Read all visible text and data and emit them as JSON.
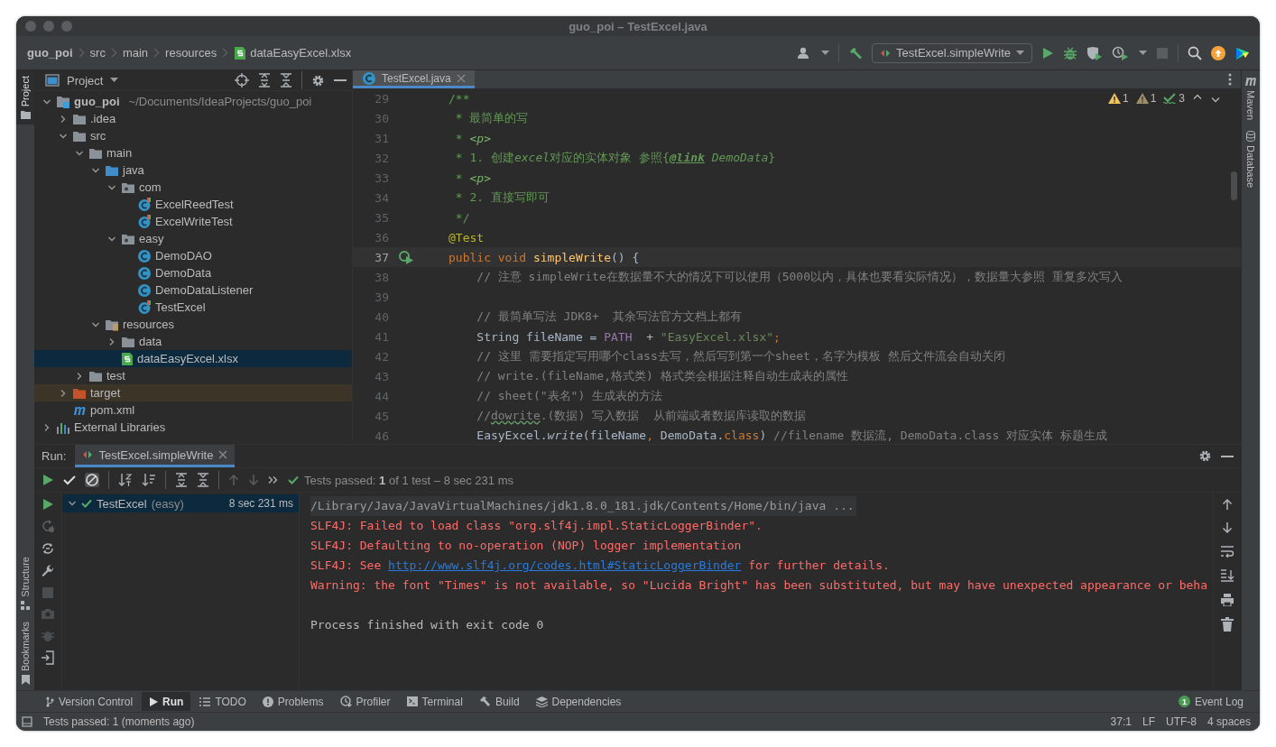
{
  "window": {
    "title": "guo_poi – TestExcel.java"
  },
  "breadcrumbs": [
    {
      "label": "guo_poi",
      "kind": "project"
    },
    {
      "label": "src",
      "kind": "folder"
    },
    {
      "label": "main",
      "kind": "folder"
    },
    {
      "label": "resources",
      "kind": "folder"
    },
    {
      "label": "dataEasyExcel.xlsx",
      "kind": "xlsx"
    }
  ],
  "run_config": {
    "label": "TestExcel.simpleWrite"
  },
  "left_stripe": [
    {
      "label": "Project",
      "selected": true,
      "kind": "project"
    },
    {
      "label": "Structure",
      "selected": false,
      "kind": "structure"
    },
    {
      "label": "Bookmarks",
      "selected": false,
      "kind": "bookmarks"
    }
  ],
  "right_stripe": [
    {
      "label": "Maven",
      "kind": "maven"
    },
    {
      "label": "Database",
      "kind": "database"
    }
  ],
  "project_panel": {
    "title": "Project",
    "tree": [
      {
        "name": "guo_poi",
        "path": "~/Documents/IdeaProjects/guo_poi",
        "kind": "module",
        "expanded": true,
        "selected": false,
        "children": [
          {
            "name": ".idea",
            "kind": "folder",
            "expanded": false,
            "selected": false
          },
          {
            "name": "src",
            "kind": "folder",
            "expanded": true,
            "selected": false,
            "children": [
              {
                "name": "main",
                "kind": "folder",
                "expanded": true,
                "selected": false,
                "children": [
                  {
                    "name": "java",
                    "kind": "source",
                    "expanded": true,
                    "selected": false,
                    "children": [
                      {
                        "name": "com",
                        "kind": "package",
                        "expanded": true,
                        "selected": false,
                        "children": [
                          {
                            "name": "ExcelReedTest",
                            "kind": "testclass",
                            "selected": false
                          },
                          {
                            "name": "ExcelWriteTest",
                            "kind": "testclass",
                            "selected": false
                          }
                        ]
                      },
                      {
                        "name": "easy",
                        "kind": "package",
                        "expanded": true,
                        "selected": false,
                        "children": [
                          {
                            "name": "DemoDAO",
                            "kind": "class",
                            "selected": false
                          },
                          {
                            "name": "DemoData",
                            "kind": "class",
                            "selected": false
                          },
                          {
                            "name": "DemoDataListener",
                            "kind": "class",
                            "selected": false
                          },
                          {
                            "name": "TestExcel",
                            "kind": "testclass",
                            "selected": false
                          }
                        ]
                      }
                    ]
                  },
                  {
                    "name": "resources",
                    "kind": "resources",
                    "expanded": true,
                    "selected": false,
                    "children": [
                      {
                        "name": "data",
                        "kind": "folder",
                        "expanded": false,
                        "selected": false
                      },
                      {
                        "name": "dataEasyExcel.xlsx",
                        "kind": "xlsx",
                        "selected": true
                      }
                    ]
                  }
                ]
              },
              {
                "name": "test",
                "kind": "folder",
                "expanded": false,
                "selected": false
              }
            ]
          },
          {
            "name": "target",
            "kind": "excluded",
            "expanded": false,
            "selected": false
          },
          {
            "name": "pom.xml",
            "kind": "maven",
            "selected": false
          }
        ]
      },
      {
        "name": "External Libraries",
        "kind": "libraries",
        "expanded": false,
        "selected": false
      }
    ]
  },
  "editor": {
    "tabs": [
      {
        "label": "TestExcel.java",
        "selected": true
      }
    ],
    "inspections": [
      {
        "kind": "warning",
        "count": "1"
      },
      {
        "kind": "weak",
        "count": "1"
      },
      {
        "kind": "typo",
        "count": "3"
      }
    ],
    "lines": [
      {
        "number": "29",
        "current": false,
        "run": false,
        "tokens": [
          {
            "kind": "doc",
            "text": "/**"
          }
        ]
      },
      {
        "number": "30",
        "current": false,
        "run": false,
        "tokens": [
          {
            "kind": "doc",
            "text": " * 最简单的写"
          }
        ]
      },
      {
        "number": "31",
        "current": false,
        "run": false,
        "tokens": [
          {
            "kind": "doc",
            "text": " * "
          },
          {
            "kind": "doctag",
            "text": "<p>"
          }
        ]
      },
      {
        "number": "32",
        "current": false,
        "run": false,
        "tokens": [
          {
            "kind": "doc",
            "text": " * 1. 创建"
          },
          {
            "kind": "doci",
            "text": "excel"
          },
          {
            "kind": "doc",
            "text": "对应的实体对象 参照{"
          },
          {
            "kind": "doclink",
            "text": "@link"
          },
          {
            "kind": "doci",
            "text": " DemoData"
          },
          {
            "kind": "doc",
            "text": "}"
          }
        ]
      },
      {
        "number": "33",
        "current": false,
        "run": false,
        "tokens": [
          {
            "kind": "doc",
            "text": " * "
          },
          {
            "kind": "doctag",
            "text": "<p>"
          }
        ]
      },
      {
        "number": "34",
        "current": false,
        "run": false,
        "tokens": [
          {
            "kind": "doc",
            "text": " * 2. 直接写即可"
          }
        ]
      },
      {
        "number": "35",
        "current": false,
        "run": false,
        "tokens": [
          {
            "kind": "doc",
            "text": " */"
          }
        ]
      },
      {
        "number": "36",
        "current": false,
        "run": false,
        "tokens": [
          {
            "kind": "annotation",
            "text": "@Test"
          }
        ]
      },
      {
        "number": "37",
        "current": true,
        "run": true,
        "tokens": [
          {
            "kind": "keyword",
            "text": "public void "
          },
          {
            "kind": "method",
            "text": "simpleWrite"
          },
          {
            "kind": "plain",
            "text": "() {"
          }
        ]
      },
      {
        "number": "38",
        "current": false,
        "run": false,
        "tokens": [
          {
            "kind": "comment",
            "text": "    // 注意 simpleWrite在数据量不大的情况下可以使用（5000以内，具体也要看实际情况），数据量大参照 重复多次写入"
          }
        ]
      },
      {
        "number": "39",
        "current": false,
        "run": false
      },
      {
        "number": "40",
        "current": false,
        "run": false,
        "tokens": [
          {
            "kind": "comment",
            "text": "    // 最简单写法 JDK8+  其余写法官方文档上都有"
          }
        ]
      },
      {
        "number": "41",
        "current": false,
        "run": false,
        "tokens": [
          {
            "kind": "plain",
            "text": "    String fileName = "
          },
          {
            "kind": "field",
            "text": "PATH"
          },
          {
            "kind": "plain",
            "text": "  + "
          },
          {
            "kind": "string",
            "text": "\"EasyExcel.xlsx\""
          },
          {
            "kind": "keyword",
            "text": ";"
          }
        ]
      },
      {
        "number": "42",
        "current": false,
        "run": false,
        "tokens": [
          {
            "kind": "comment",
            "text": "    // 这里 需要指定写用哪个class去写，然后写到第一个sheet，名字为模板 然后文件流会自动关闭"
          }
        ]
      },
      {
        "number": "43",
        "current": false,
        "run": false,
        "tokens": [
          {
            "kind": "comment",
            "text": "    // write.(fileName,格式类) 格式类会根据注释自动生成表的属性"
          }
        ]
      },
      {
        "number": "44",
        "current": false,
        "run": false,
        "tokens": [
          {
            "kind": "comment",
            "text": "    // sheet(\"表名\") 生成表的方法"
          }
        ]
      },
      {
        "number": "45",
        "current": false,
        "run": false,
        "tokens": [
          {
            "kind": "comment",
            "text": "    //"
          },
          {
            "kind": "typo",
            "text": "dowrite"
          },
          {
            "kind": "comment",
            "text": ".(数据) 写入数据  从前端或者数据库读取的数据"
          }
        ]
      },
      {
        "number": "46",
        "current": false,
        "run": false,
        "tokens": [
          {
            "kind": "plain",
            "text": "    EasyExcel."
          },
          {
            "kind": "italic",
            "text": "write"
          },
          {
            "kind": "plain",
            "text": "(fileName"
          },
          {
            "kind": "keyword",
            "text": ", "
          },
          {
            "kind": "plain",
            "text": "DemoData."
          },
          {
            "kind": "keyword",
            "text": "class"
          },
          {
            "kind": "plain",
            "text": ") "
          },
          {
            "kind": "comment",
            "text": "//filename 数据流, DemoData.class 对应实体 标题生成"
          }
        ]
      }
    ]
  },
  "run_panel": {
    "label": "Run:",
    "tabs": [
      {
        "label": "TestExcel.simpleWrite",
        "selected": true
      }
    ],
    "summary": "Tests passed: **1** of 1 test – 8 sec 231 ms",
    "tests": [
      {
        "name": "TestExcel",
        "package": "(easy)",
        "time": "8 sec 231 ms",
        "passed": true,
        "selected": true
      }
    ],
    "console": [
      {
        "kind": "command",
        "parts": [
          {
            "text": "/Library/Java/JavaVirtualMachines/jdk1.8.0_181.jdk/Contents/Home/bin/java ..."
          }
        ]
      },
      {
        "kind": "error",
        "parts": [
          {
            "text": "SLF4J: Failed to load class \"org.slf4j.impl.StaticLoggerBinder\"."
          }
        ]
      },
      {
        "kind": "error",
        "parts": [
          {
            "text": "SLF4J: Defaulting to no-operation (NOP) logger implementation"
          }
        ]
      },
      {
        "kind": "error",
        "parts": [
          {
            "text": "SLF4J: See "
          },
          {
            "text": "http://www.slf4j.org/codes.html#StaticLoggerBinder",
            "link": true
          },
          {
            "text": " for further details."
          }
        ]
      },
      {
        "kind": "error",
        "parts": [
          {
            "text": "Warning: the font \"Times\" is not available, so \"Lucida Bright\" has been substituted, but may have unexpected appearance or beha"
          }
        ]
      },
      {
        "kind": "blank"
      },
      {
        "kind": "output",
        "parts": [
          {
            "text": "Process finished with exit code 0"
          }
        ]
      }
    ]
  },
  "tool_windows": [
    {
      "label": "Version Control",
      "kind": "vcs",
      "selected": false
    },
    {
      "label": "Run",
      "kind": "run",
      "selected": true
    },
    {
      "label": "TODO",
      "kind": "todo",
      "selected": false
    },
    {
      "label": "Problems",
      "kind": "problems",
      "selected": false
    },
    {
      "label": "Profiler",
      "kind": "profiler",
      "selected": false
    },
    {
      "label": "Terminal",
      "kind": "terminal",
      "selected": false
    },
    {
      "label": "Build",
      "kind": "build",
      "selected": false
    },
    {
      "label": "Dependencies",
      "kind": "dependencies",
      "selected": false
    }
  ],
  "event_log": {
    "label": "Event Log",
    "badge": "1"
  },
  "status_bar": {
    "message": "Tests passed: 1 (moments ago)",
    "items": [
      "37:1",
      "LF",
      "UTF-8",
      "4 spaces"
    ]
  }
}
